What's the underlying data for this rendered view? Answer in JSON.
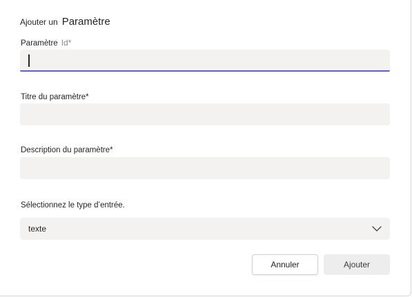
{
  "dialog": {
    "title_prefix": "Ajouter un",
    "title_main": "Paramètre"
  },
  "fields": {
    "param_id": {
      "label": "Paramètre",
      "label_suffix": "Id*",
      "value": ""
    },
    "param_title": {
      "label": "Titre du paramètre*",
      "value": ""
    },
    "param_description": {
      "label": "Description du paramètre*",
      "value": ""
    },
    "input_type": {
      "label": "Sélectionnez le type d’entrée.",
      "selected": "texte"
    }
  },
  "actions": {
    "cancel_label": "Annuler",
    "add_label": "Ajouter"
  },
  "colors": {
    "focus_accent": "#5b5fc7",
    "field_bg": "#f3f2f1",
    "disabled_button_bg": "#ededed"
  },
  "icons": {
    "select_chevron": "chevron-down-icon"
  }
}
